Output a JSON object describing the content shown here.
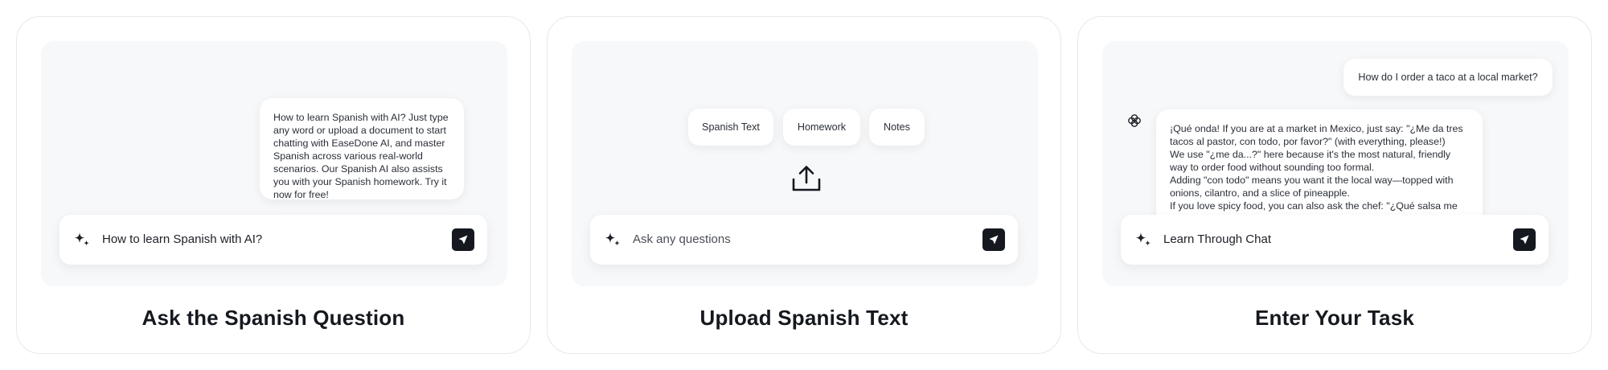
{
  "cards": [
    {
      "title": "Ask the Spanish Question",
      "bubble_text": "How to learn Spanish with AI? Just type any word or upload a document to start chatting with EaseDone AI, and master Spanish across various real-world scenarios. Our Spanish AI also assists you with your Spanish homework. Try it now for free!",
      "input_text": "How to learn Spanish with AI?"
    },
    {
      "title": "Upload Spanish Text",
      "chips": [
        "Spanish Text",
        "Homework",
        "Notes"
      ],
      "input_placeholder": "Ask any questions"
    },
    {
      "title": "Enter Your Task",
      "question": "How do I order a taco at a local market?",
      "answer_lines": [
        "¡Qué onda! If you are at a market in Mexico, just say: \"¿Me da tres tacos al pastor, con todo, por favor?\" (with everything, please!)",
        "We use \"¿me da...?\" here because it's the most natural, friendly way to order food without sounding too formal.",
        "Adding \"con todo\" means you want it the local way—topped with onions, cilantro, and a slice of pineapple.",
        "If you love spicy food, you can also ask the chef: \"¿Qué salsa me"
      ],
      "input_text": "Learn Through Chat"
    }
  ],
  "icons": {
    "input_leading": "sparkle-icon",
    "send": "send-arrow-icon",
    "upload": "upload-icon",
    "assistant": "ai-logo-icon"
  },
  "colors": {
    "stage_bg": "#f7f8fa",
    "send_button": "#15191f",
    "card_border": "#e6e8eb"
  }
}
